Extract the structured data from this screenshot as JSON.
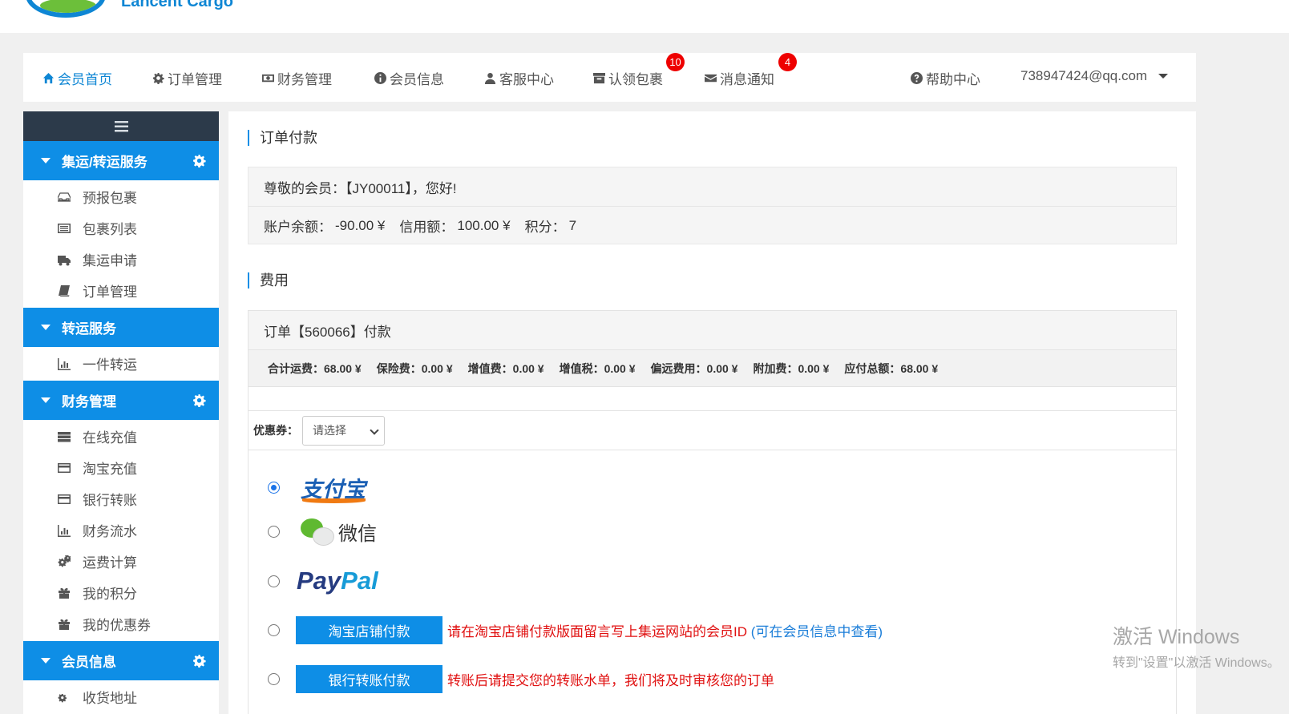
{
  "brand": {
    "name": "Lancent Cargo"
  },
  "colors": {
    "accent": "#0e8ee6",
    "sidebar_dark": "#2c3a4a",
    "badge": "#ee0000",
    "warning_text": "#e01010",
    "link": "#1a7dd8"
  },
  "topnav": {
    "items": [
      {
        "label": "会员首页",
        "icon": "home-icon",
        "active": true
      },
      {
        "label": "订单管理",
        "icon": "gear-icon"
      },
      {
        "label": "财务管理",
        "icon": "money-icon"
      },
      {
        "label": "会员信息",
        "icon": "info-icon"
      },
      {
        "label": "客服中心",
        "icon": "user-icon"
      },
      {
        "label": "认领包裹",
        "icon": "archive-icon",
        "badge": "10"
      },
      {
        "label": "消息通知",
        "icon": "envelope-icon",
        "badge": "4"
      }
    ],
    "help": "帮助中心",
    "account": "738947424@qq.com"
  },
  "sidebar": {
    "groups": [
      {
        "title": "集运/转运服务",
        "items": [
          "预报包裹",
          "包裹列表",
          "集运申请",
          "订单管理"
        ]
      },
      {
        "title": "转运服务",
        "items": [
          "一件转运"
        ]
      },
      {
        "title": "财务管理",
        "items": [
          "在线充值",
          "淘宝充值",
          "银行转账",
          "财务流水",
          "运费计算",
          "我的积分",
          "我的优惠券"
        ]
      },
      {
        "title": "会员信息",
        "items": [
          "收货地址"
        ]
      }
    ]
  },
  "main": {
    "title": "订单付款",
    "greeting": "尊敬的会员：【JY00011】，您好!",
    "balance_label": "账户余额：",
    "balance_value": "-90.00 ¥",
    "credit_label": "信用额：",
    "credit_value": "100.00 ¥",
    "points_label": "积分：",
    "points_value": "7",
    "fees_title": "费用",
    "order_header": "订单【560066】付款",
    "fees": [
      {
        "label": "合计运费：",
        "value": "68.00 ¥"
      },
      {
        "label": "保险费：",
        "value": "0.00 ¥"
      },
      {
        "label": "增值费：",
        "value": "0.00 ¥"
      },
      {
        "label": "增值税：",
        "value": "0.00 ¥"
      },
      {
        "label": "偏远费用：",
        "value": "0.00 ¥"
      },
      {
        "label": "附加费：",
        "value": "0.00 ¥"
      },
      {
        "label": "应付总额：",
        "value": "68.00 ¥"
      }
    ],
    "coupon_label": "优惠券：",
    "coupon_selected": "请选择",
    "payments": {
      "alipay": "支付宝",
      "wechat": "微信",
      "paypal_a": "Pay",
      "paypal_b": "Pal",
      "taobao_button": "淘宝店铺付款",
      "taobao_note": "请在淘宝店铺付款版面留言写上集运网站的会员ID",
      "taobao_link": "(可在会员信息中查看)",
      "bank_button": "银行转账付款",
      "bank_note": "转账后请提交您的转账水单，我们将及时审核您的订单"
    }
  },
  "watermark": {
    "line1": "激活 Windows",
    "line2": "转到\"设置\"以激活 Windows。"
  }
}
